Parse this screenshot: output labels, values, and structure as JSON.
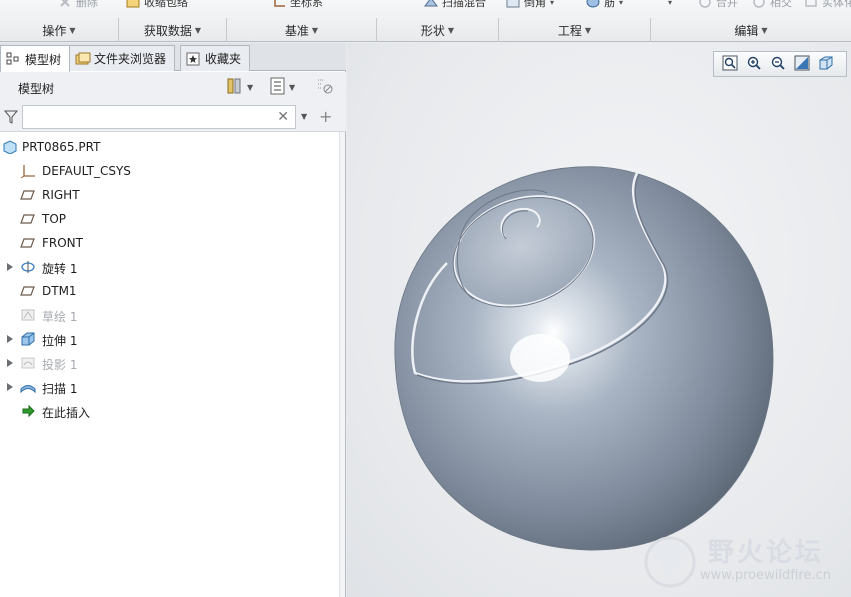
{
  "ribbon": {
    "commands": [
      {
        "label": "删除",
        "icon": "delete-icon"
      },
      {
        "label": "收缩包络",
        "icon": "shrinkwrap-icon"
      },
      {
        "label": "坐标系",
        "icon": "csys-icon"
      },
      {
        "label": "扫描混合",
        "icon": "sweep-blend-icon"
      },
      {
        "label": "倒角",
        "icon": "chamfer-icon"
      },
      {
        "label": "筋",
        "icon": "rib-icon"
      },
      {
        "label": "合并",
        "icon": "merge-icon"
      },
      {
        "label": "相交",
        "icon": "intersect-icon"
      },
      {
        "label": "实体化",
        "icon": "solidify-icon"
      }
    ],
    "groups": [
      "操作",
      "获取数据",
      "基准",
      "形状",
      "工程",
      "编辑"
    ]
  },
  "tabs": [
    {
      "label": "模型树",
      "icon": "model-tree-icon"
    },
    {
      "label": "文件夹浏览器",
      "icon": "folder-browser-icon"
    },
    {
      "label": "收藏夹",
      "icon": "favorites-icon"
    }
  ],
  "panel": {
    "title": "模型树",
    "filter_placeholder": ""
  },
  "tree": [
    {
      "label": "PRT0865.PRT",
      "icon": "part-icon",
      "expandable": false,
      "dim": false
    },
    {
      "label": "DEFAULT_CSYS",
      "icon": "csys-icon",
      "expandable": false,
      "dim": false
    },
    {
      "label": "RIGHT",
      "icon": "datum-plane-icon",
      "expandable": false,
      "dim": false
    },
    {
      "label": "TOP",
      "icon": "datum-plane-icon",
      "expandable": false,
      "dim": false
    },
    {
      "label": "FRONT",
      "icon": "datum-plane-icon",
      "expandable": false,
      "dim": false
    },
    {
      "label": "旋转 1",
      "icon": "revolve-icon",
      "expandable": true,
      "dim": false
    },
    {
      "label": "DTM1",
      "icon": "datum-plane-icon",
      "expandable": false,
      "dim": false
    },
    {
      "label": "草绘 1",
      "icon": "sketch-icon",
      "expandable": false,
      "dim": true
    },
    {
      "label": "拉伸 1",
      "icon": "extrude-icon",
      "expandable": true,
      "dim": false
    },
    {
      "label": "投影 1",
      "icon": "project-icon",
      "expandable": true,
      "dim": true
    },
    {
      "label": "扫描 1",
      "icon": "sweep-icon",
      "expandable": true,
      "dim": false
    },
    {
      "label": "在此插入",
      "icon": "insert-here-icon",
      "expandable": false,
      "dim": false
    }
  ],
  "view_toolbar": [
    "refit-icon",
    "zoom-in-icon",
    "zoom-out-icon",
    "repaint-icon",
    "display-style-icon"
  ],
  "watermark": {
    "title": "野火论坛",
    "url": "www.proewildfire.cn"
  },
  "colors": {
    "model_body": "#8e9aab",
    "viewport_bg": "#e9ebee",
    "panel_bg": "#ffffff",
    "accent": "#2a6fb5"
  }
}
